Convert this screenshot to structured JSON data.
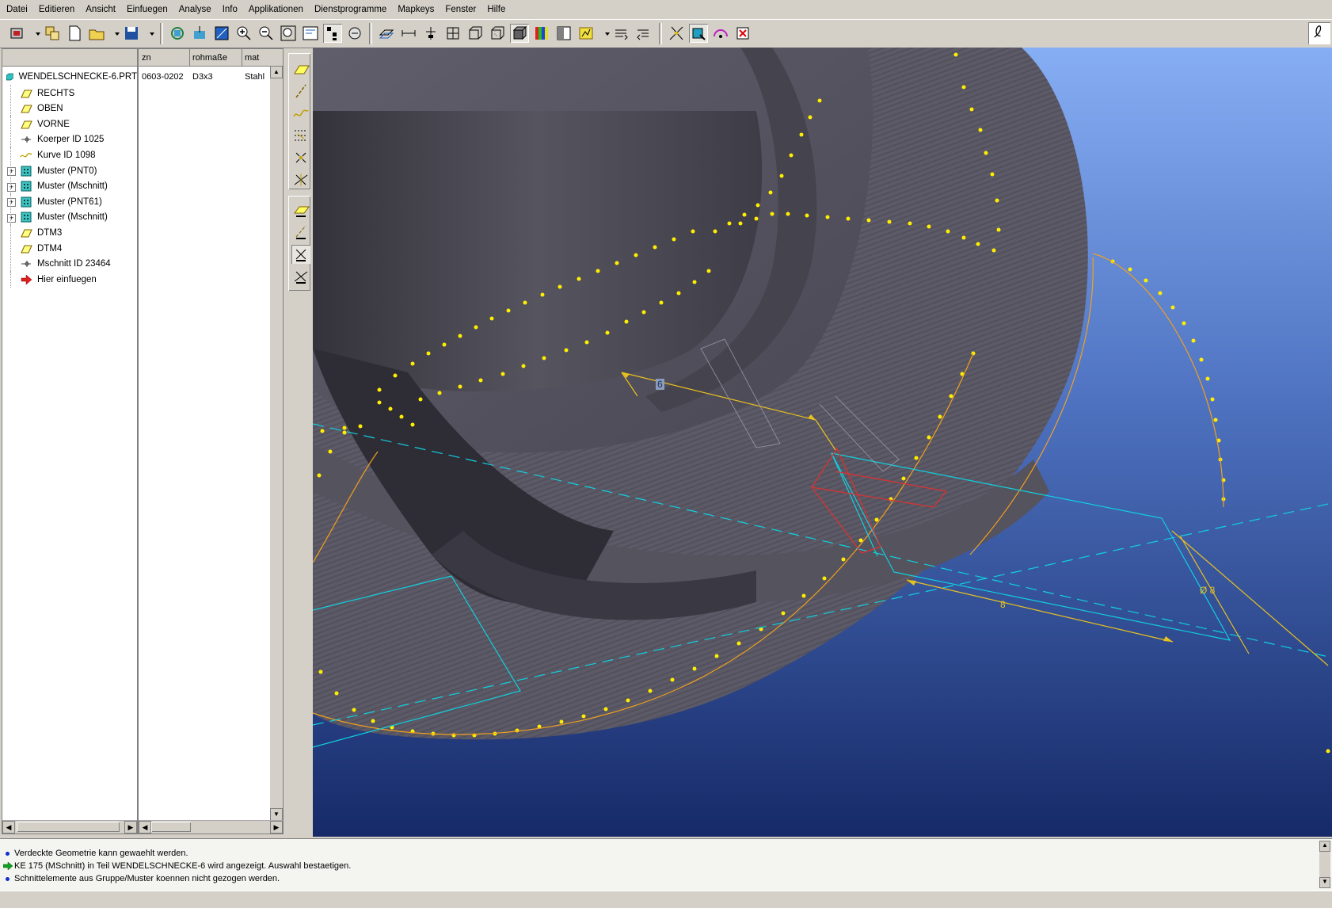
{
  "menu": [
    "Datei",
    "Editieren",
    "Ansicht",
    "Einfuegen",
    "Analyse",
    "Info",
    "Applikationen",
    "Dienstprogramme",
    "Mapkeys",
    "Fenster",
    "Hilfe"
  ],
  "tree": {
    "root": "WENDELSCHNECKE-6.PRT",
    "items": [
      {
        "label": "RECHTS",
        "icon": "datum-plane-icon",
        "expand": false
      },
      {
        "label": "OBEN",
        "icon": "datum-plane-icon",
        "expand": false
      },
      {
        "label": "VORNE",
        "icon": "datum-plane-icon",
        "expand": false
      },
      {
        "label": "Koerper ID 1025",
        "icon": "body-icon",
        "expand": false
      },
      {
        "label": "Kurve ID 1098",
        "icon": "curve-icon",
        "expand": false
      },
      {
        "label": "Muster (PNT0)",
        "icon": "pattern-icon",
        "expand": true
      },
      {
        "label": "Muster (Mschnitt)",
        "icon": "pattern-icon",
        "expand": true
      },
      {
        "label": "Muster (PNT61)",
        "icon": "pattern-icon",
        "expand": true
      },
      {
        "label": "Muster (Mschnitt)",
        "icon": "pattern-icon",
        "expand": true
      },
      {
        "label": "DTM3",
        "icon": "datum-plane-icon",
        "expand": false
      },
      {
        "label": "DTM4",
        "icon": "datum-plane-icon",
        "expand": false
      },
      {
        "label": "Mschnitt ID 23464",
        "icon": "body-icon",
        "expand": false
      },
      {
        "label": "Hier einfuegen",
        "icon": "insert-arrow-icon",
        "expand": false
      }
    ]
  },
  "columns": {
    "headers": [
      "zn",
      "rohmaße",
      "mat"
    ],
    "values": [
      "0603-0202",
      "D3x3",
      "Stahl"
    ]
  },
  "viewport": {
    "dim_6": "6",
    "dim_8": "8",
    "dim_d8": "Ø 8",
    "colors": {
      "bg_top": "#7ea7f0",
      "bg_bottom": "#1a2d6e",
      "part": "#5a5864",
      "points": "#ffee00",
      "datum": "#00d0e0",
      "dim": "#e8c020",
      "section": "#e03030"
    }
  },
  "messages": [
    {
      "icon": "info-dot-icon",
      "text": "Verdeckte Geometrie kann gewaehlt werden."
    },
    {
      "icon": "prompt-arrow-icon",
      "text": "KE 175 (MSchnitt) in Teil WENDELSCHNECKE-6 wird angezeigt. Auswahl bestaetigen."
    },
    {
      "icon": "info-dot-icon",
      "text": "Schnittelemente aus Gruppe/Muster koennen nicht gezogen werden."
    }
  ]
}
